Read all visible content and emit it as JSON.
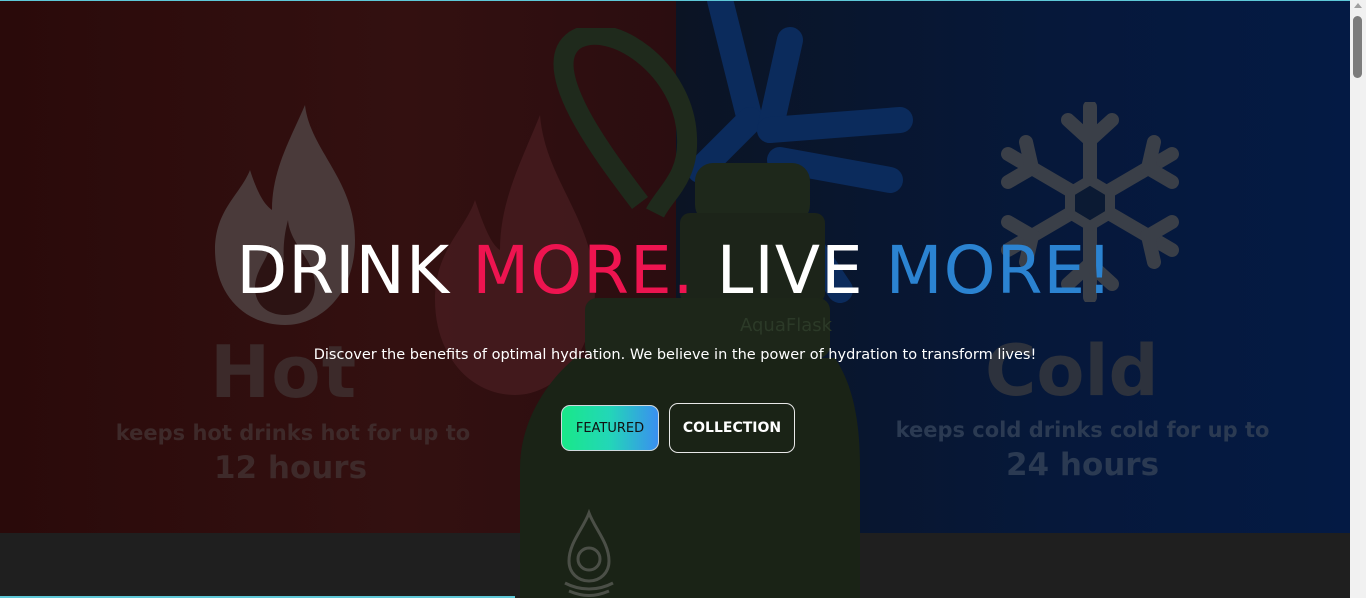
{
  "hero": {
    "title_part1": "DRINK ",
    "title_part2": "MORE.",
    "title_part3": " LIVE ",
    "title_part4": "MORE!",
    "subtitle": "Discover the benefits of optimal hydration. We believe in the power of hydration to transform lives!"
  },
  "buttons": {
    "featured_label": "FEATURED",
    "collection_label": "COLLECTION"
  },
  "background": {
    "hot_title": "Hot",
    "hot_subtitle": "keeps hot drinks hot for up to",
    "hot_hours": "12 hours",
    "cold_title": "Cold",
    "cold_subtitle": "keeps cold drinks cold for up to",
    "cold_hours": "24 hours",
    "bottle_brand": "AquaFlask"
  },
  "colors": {
    "accent_pink": "#ee1450",
    "accent_blue": "#2b83d1",
    "cyan_line": "#5ec8d8"
  },
  "icons": [
    "flame-icon",
    "snowflake-icon",
    "water-drop-logo-icon"
  ]
}
